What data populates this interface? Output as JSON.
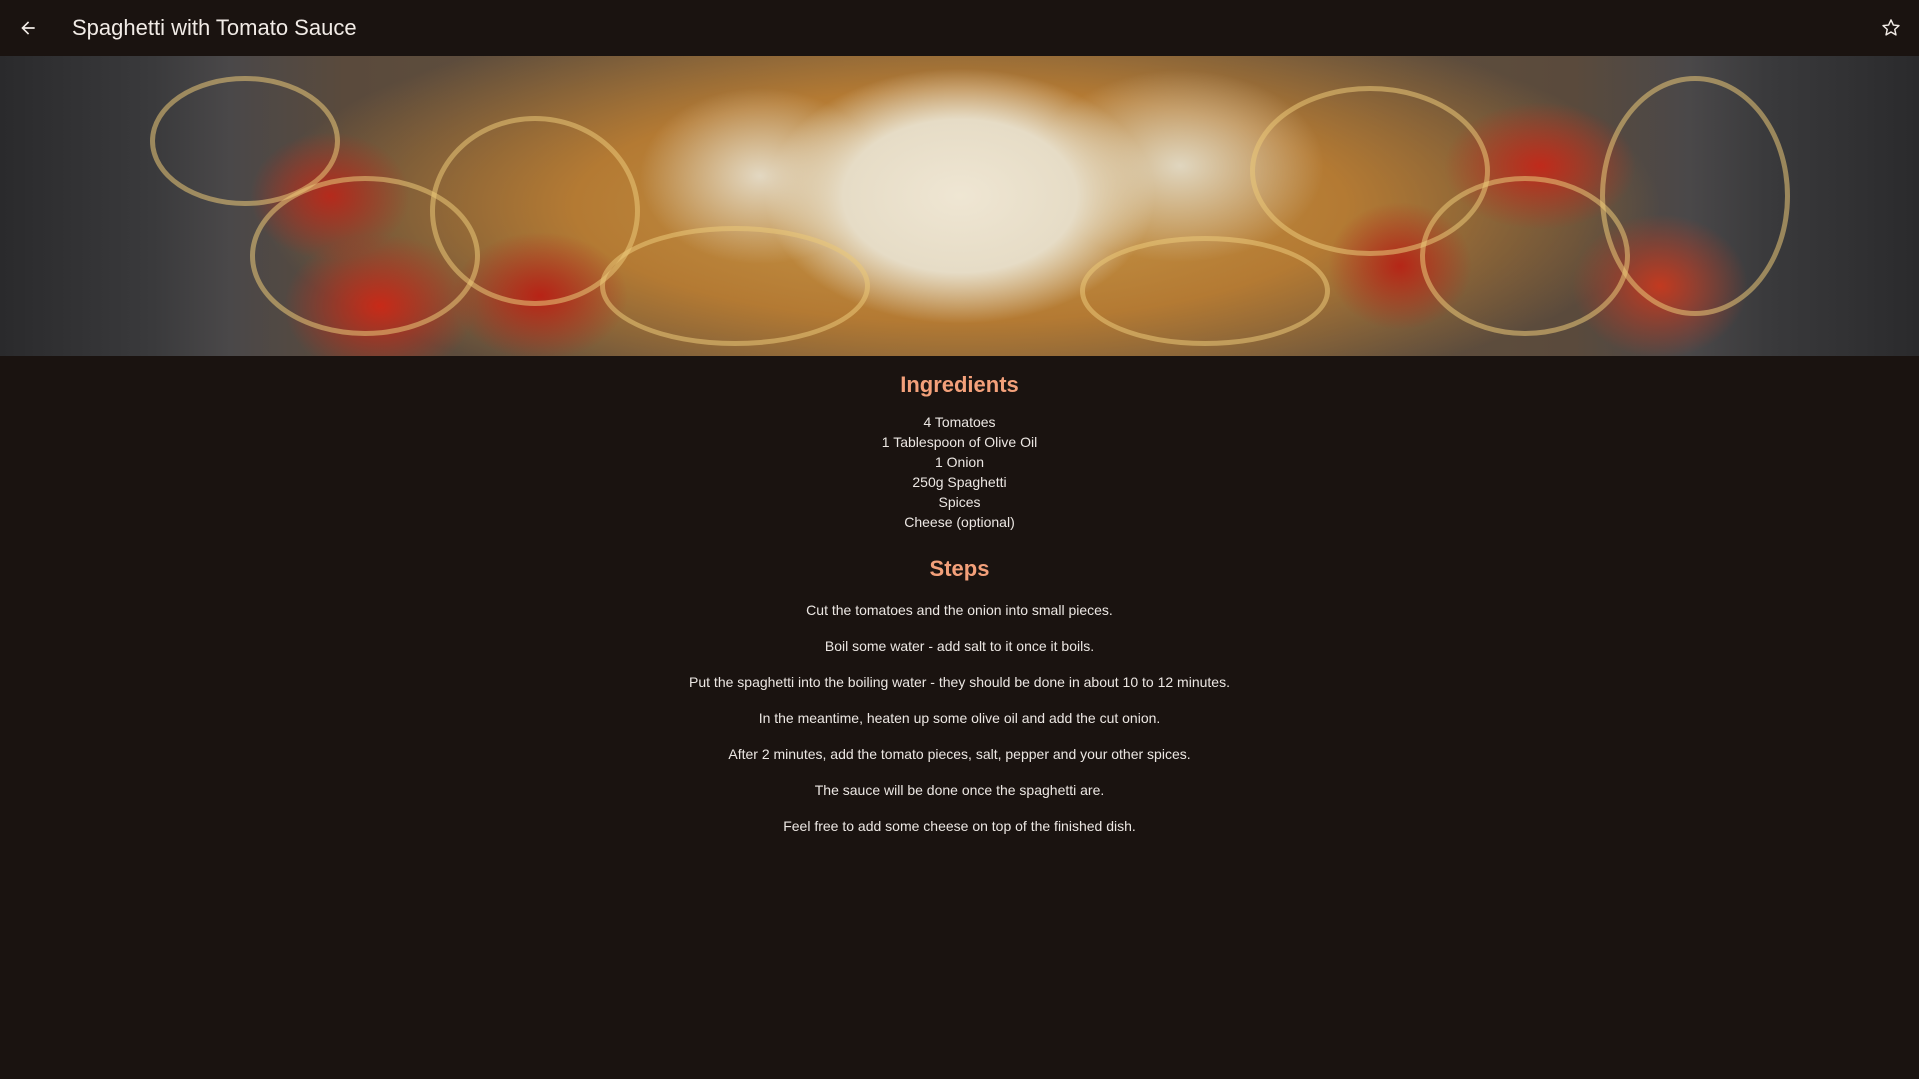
{
  "appbar": {
    "title": "Spaghetti with Tomato Sauce",
    "back_icon": "arrow-back-icon",
    "favorite_icon": "star-outline-icon"
  },
  "colors": {
    "background": "#1a1310",
    "heading": "#f3a07a",
    "text": "#ece7e3"
  },
  "ingredients": {
    "heading": "Ingredients",
    "items": [
      "4 Tomatoes",
      "1 Tablespoon of Olive Oil",
      "1 Onion",
      "250g Spaghetti",
      "Spices",
      "Cheese (optional)"
    ]
  },
  "steps": {
    "heading": "Steps",
    "items": [
      "Cut the tomatoes and the onion into small pieces.",
      "Boil some water - add salt to it once it boils.",
      "Put the spaghetti into the boiling water - they should be done in about 10 to 12 minutes.",
      "In the meantime, heaten up some olive oil and add the cut onion.",
      "After 2 minutes, add the tomato pieces, salt, pepper and your other spices.",
      "The sauce will be done once the spaghetti are.",
      "Feel free to add some cheese on top of the finished dish."
    ]
  }
}
